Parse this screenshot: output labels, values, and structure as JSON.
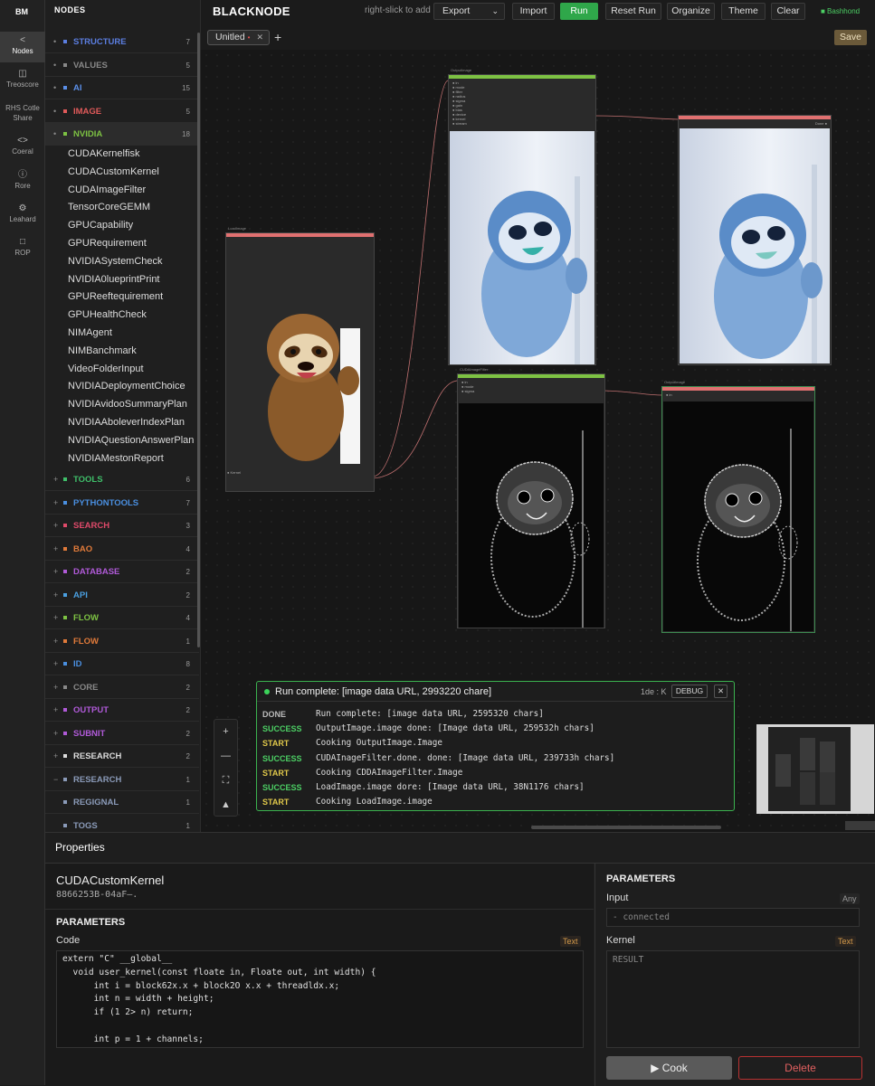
{
  "app": {
    "logo": "BM",
    "title": "BLACKNODE",
    "hint": "right-slick to add",
    "status": "■ Bashhond"
  },
  "rail": [
    {
      "label": "Nodes",
      "icon": "share-icon"
    },
    {
      "label": "Treoscore",
      "icon": "copy-icon"
    },
    {
      "label": "RHS Cotle Share",
      "icon": "share-icon"
    },
    {
      "label": "Coeral",
      "icon": "code-icon"
    },
    {
      "label": "Rore",
      "icon": "help-icon"
    },
    {
      "label": "Leahard",
      "icon": "settings-icon"
    },
    {
      "label": "ROP",
      "icon": "folder-icon"
    }
  ],
  "nodes_panel": {
    "header": "NODES",
    "categories": [
      {
        "toggle": "•",
        "name": "STRUCTURE",
        "count": "7",
        "color": "#5b7ee0"
      },
      {
        "toggle": "•",
        "name": "VALUES",
        "count": "5",
        "color": "#888888"
      },
      {
        "toggle": "•",
        "name": "AI",
        "count": "15",
        "color": "#5b8fe8"
      },
      {
        "toggle": "•",
        "name": "IMAGE",
        "count": "5",
        "color": "#e05a5a"
      },
      {
        "toggle": "•",
        "name": "NVIDIA",
        "count": "18",
        "color": "#7dc243"
      }
    ],
    "nvidia_items": [
      "CUDAKernelfisk",
      "CUDACustomKernel",
      "CUDAImageFilter",
      "TensorCoreGEMM",
      "GPUCapability",
      "GPURequirement",
      "NVIDIASystemCheck",
      "NVIDIA0lueprintPrint",
      "GPUReeftequirement",
      "GPUHealthCheck",
      "NIMAgent",
      "NIMBanchmark",
      "VideoFolderInput",
      "NVIDIADeploymentChoice",
      "NVIDIAvidooSummaryPlan",
      "NVIDIAAboleverIndexPlan",
      "NVIDIAQuestionAnswerPlan",
      "NVIDIAMestonReport"
    ],
    "categories_after": [
      {
        "toggle": "+",
        "name": "TOOLS",
        "count": "6",
        "color": "#3fbf6a"
      },
      {
        "toggle": "+",
        "name": "PYTHONTOOLS",
        "count": "7",
        "color": "#4a8fe0"
      },
      {
        "toggle": "+",
        "name": "SEARCH",
        "count": "3",
        "color": "#e04a6a"
      },
      {
        "toggle": "+",
        "name": "BAO",
        "count": "4",
        "color": "#e07a3a"
      },
      {
        "toggle": "+",
        "name": "DATABASE",
        "count": "2",
        "color": "#b05ad8"
      },
      {
        "toggle": "+",
        "name": "API",
        "count": "2",
        "color": "#4a9fe0"
      },
      {
        "toggle": "+",
        "name": "FLOW",
        "count": "4",
        "color": "#7dc243"
      },
      {
        "toggle": "+",
        "name": "FLOW",
        "count": "1",
        "color": "#e07a3a"
      },
      {
        "toggle": "+",
        "name": "ID",
        "count": "8",
        "color": "#4a8fe0"
      },
      {
        "toggle": "+",
        "name": "CORE",
        "count": "2",
        "color": "#888888"
      },
      {
        "toggle": "+",
        "name": "OUTPUT",
        "count": "2",
        "color": "#b05ad8"
      },
      {
        "toggle": "+",
        "name": "SUBNIT",
        "count": "2",
        "color": "#b05ad8"
      },
      {
        "toggle": "+",
        "name": "RESEARCH",
        "count": "2",
        "color": "#dddddd"
      },
      {
        "toggle": "−",
        "name": "RESEARCH",
        "count": "1",
        "color": "#8a9ab8"
      },
      {
        "toggle": "",
        "name": "REGIGNAL",
        "count": "1",
        "color": "#8a9ab8"
      },
      {
        "toggle": "",
        "name": "TOGS",
        "count": "1",
        "color": "#8a9ab8"
      }
    ]
  },
  "toolbar": {
    "export": "Export",
    "import": "Import",
    "run": "Run",
    "reset": "Reset Run",
    "organize": "Organize",
    "theme": "Theme",
    "clear": "Clear",
    "save": "Save"
  },
  "tabs": [
    {
      "label": "Unitled"
    }
  ],
  "canvas_nodes": {
    "load": {
      "label": "LoadImage",
      "color": "#e07070"
    },
    "filter_top": {
      "label": "OutputImage",
      "color": "#7dc243"
    },
    "out_top": {
      "label": "Preview",
      "color": "#e07070"
    },
    "filter_bottom": {
      "label": "CUDAImageFilter",
      "color": "#7dc243"
    },
    "out_bottom": {
      "label": "OutputImage",
      "color": "#e07070"
    }
  },
  "log": {
    "title": "Run complete: [image data URL, 2993220 chare]",
    "meta": "1de : K",
    "debug": "DEBUG",
    "close": "✕",
    "entries": [
      {
        "level": "DONE",
        "color": "#bbbbbb",
        "msg": "Run complete: [image data URL, 2595320 chars]"
      },
      {
        "level": "SUCCESS",
        "color": "#4ccf64",
        "msg": "OutputImage.image done: [Image data URL, 259532h chars]"
      },
      {
        "level": "START",
        "color": "#e0c84a",
        "msg": "Cooking OutputImage.Image"
      },
      {
        "level": "SUCCESS",
        "color": "#4ccf64",
        "msg": "CUDAInageFilter.done. done: [Image data URL, 239733h chars]"
      },
      {
        "level": "START",
        "color": "#e0c84a",
        "msg": "Cooking CDDAImageFilter.Image"
      },
      {
        "level": "SUCCESS",
        "color": "#4ccf64",
        "msg": "LoadImage.image dore: [Image data URL, 38N1176 chars]"
      },
      {
        "level": "START",
        "color": "#e0c84a",
        "msg": "Cooking LoadImage.image"
      }
    ]
  },
  "properties": {
    "title": "Properties",
    "node_name": "CUDACustomKernel",
    "node_id": "8866253B-04aF–.",
    "params_label": "PARAMETERS",
    "code_label": "Code",
    "code_type": "Text",
    "code": "extern \"C\" __global__\n  void user_kernel(const floate in, Floate out, int width) {\n      int i = block62x.x + block2O x.x + threadldx.x;\n      int n = width + height;\n      if (1 2> n) return;\n\n      int p = 1 + channels;",
    "right_params_label": "PARAMETERS",
    "input_label": "Input",
    "input_type": "Any",
    "input_value": "- connected",
    "kernel_label": "Kernel",
    "kernel_type": "Text",
    "kernel_placeholder": "RESULT",
    "cook": "▶ Cook",
    "delete": "Delete"
  }
}
